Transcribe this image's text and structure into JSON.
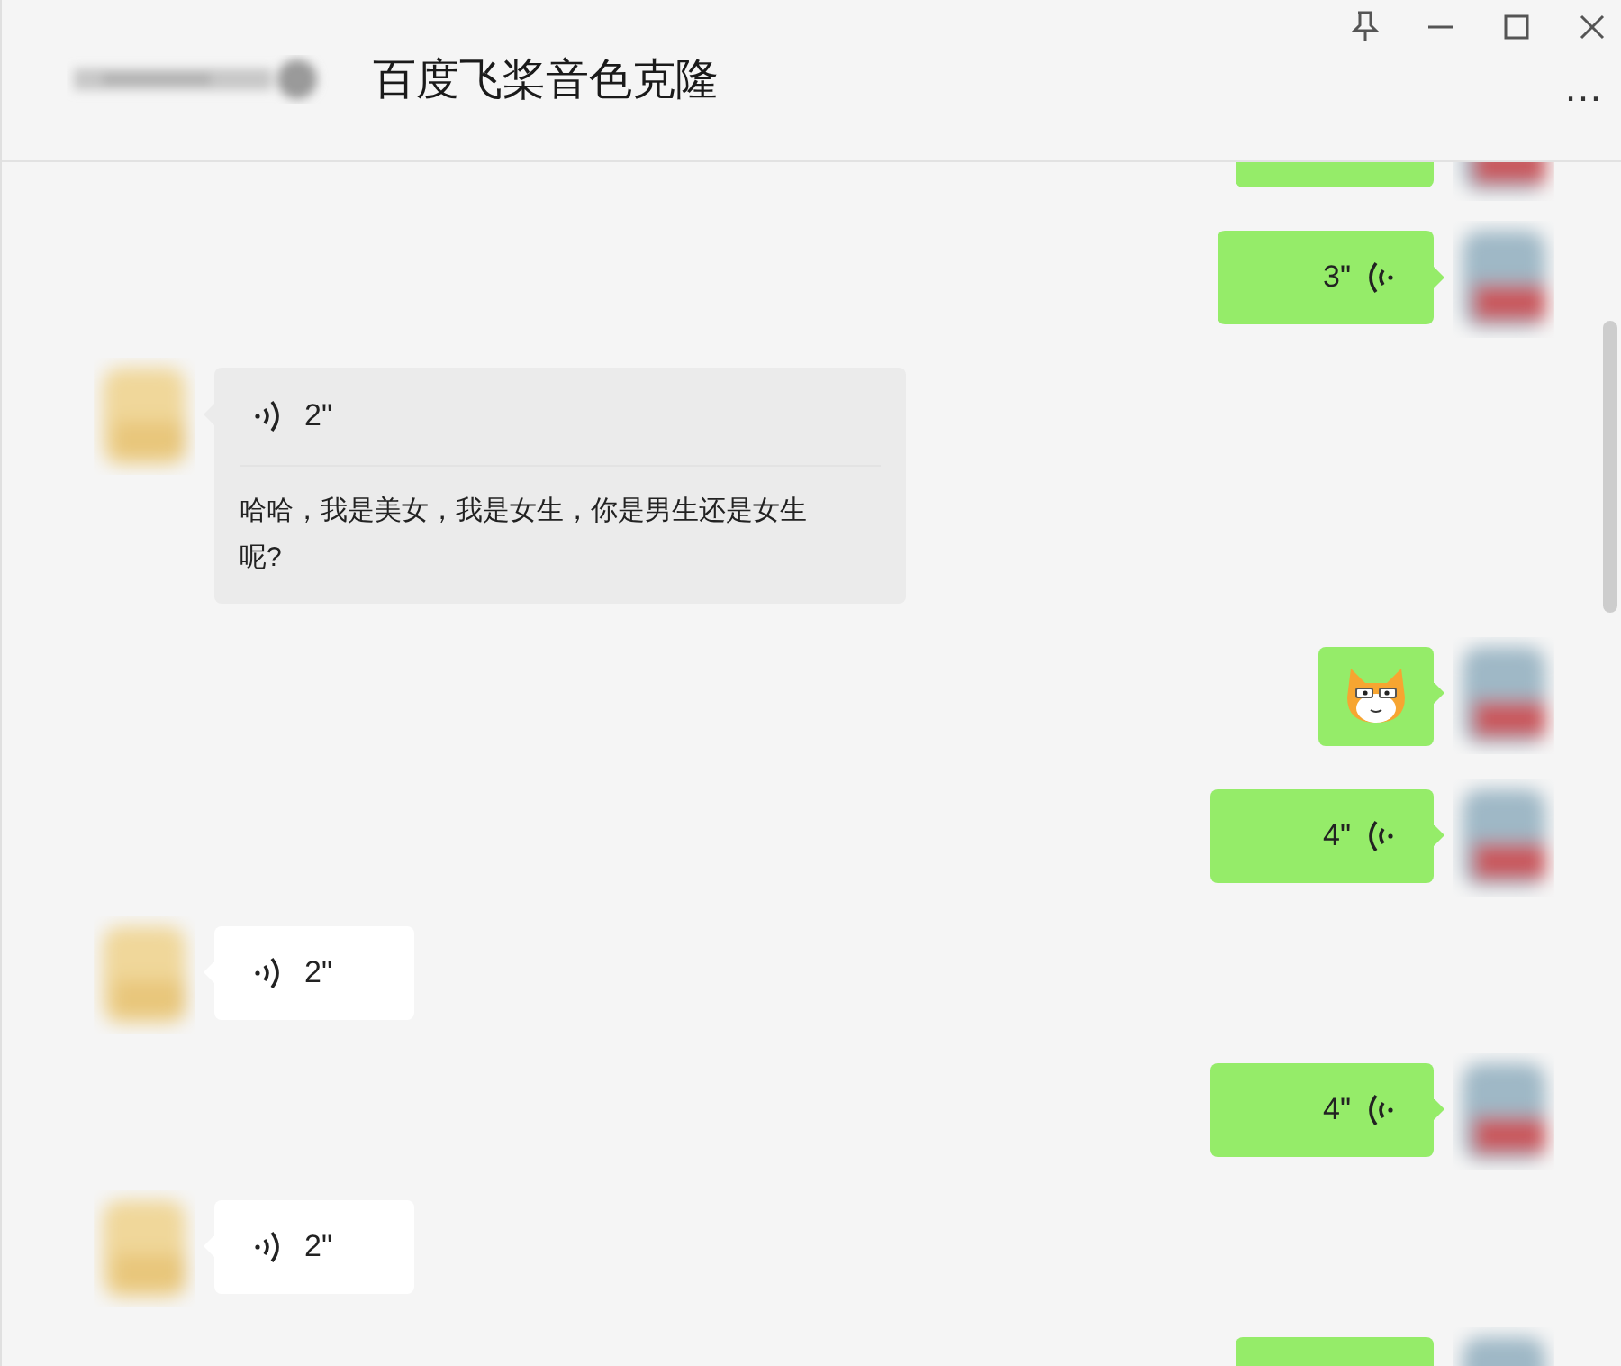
{
  "window": {
    "title": "百度飞桨音色克隆",
    "more": "…"
  },
  "messages": [
    {
      "kind": "partial",
      "outgoing": true
    },
    {
      "kind": "voice",
      "outgoing": true,
      "duration": "3\""
    },
    {
      "kind": "voice_text",
      "outgoing": false,
      "duration": "2\"",
      "transcript": "哈哈，我是美女，我是女生，你是男生还是女生呢?"
    },
    {
      "kind": "sticker",
      "outgoing": true
    },
    {
      "kind": "voice",
      "outgoing": true,
      "duration": "4\""
    },
    {
      "kind": "voice",
      "outgoing": false,
      "duration": "2\""
    },
    {
      "kind": "voice",
      "outgoing": true,
      "duration": "4\""
    },
    {
      "kind": "voice",
      "outgoing": false,
      "duration": "2\""
    },
    {
      "kind": "partial",
      "outgoing": true
    }
  ]
}
